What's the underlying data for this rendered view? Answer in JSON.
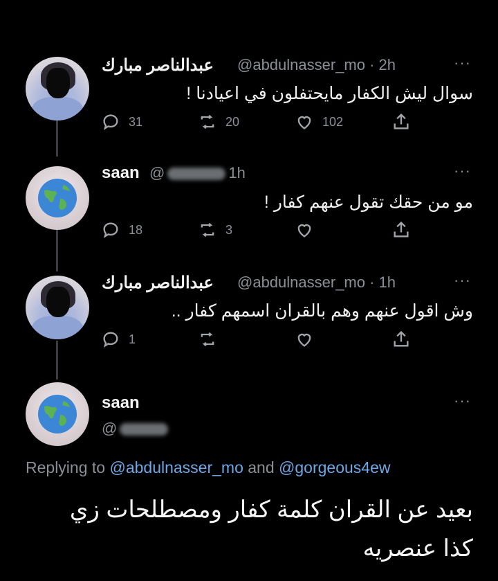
{
  "tweets": [
    {
      "name": "عبدالناصر مبارك",
      "handle": "@abdulnasser_mo · 2h",
      "more": "···",
      "text": "سوال ليش الكفار مايحتفلون في اعيادنا !",
      "replies": "31",
      "retweets": "20",
      "likes": "102"
    },
    {
      "name": "saan",
      "handle_prefix": "@",
      "handle_suffix": "1h",
      "more": "···",
      "text": "مو من حقك تقول عنهم كفار !",
      "replies": "18",
      "retweets": "3",
      "likes": ""
    },
    {
      "name": "عبدالناصر مبارك",
      "handle": "@abdulnasser_mo · 1h",
      "more": "···",
      "text": "وش اقول عنهم وهم بالقران اسمهم كفار ..",
      "replies": "1",
      "retweets": "",
      "likes": ""
    },
    {
      "name": "saan",
      "handle_prefix": "@",
      "more": "···"
    }
  ],
  "replying": {
    "prefix": "Replying to",
    "user1": "@abdulnasser_mo",
    "and": "and",
    "user2": "@gorgeous4ew"
  },
  "main_text": {
    "line1": "بعيد عن القران كلمة كفار ومصطلحات زي",
    "line2": "كذا عنصريه"
  },
  "icons": [
    "reply-icon",
    "retweet-icon",
    "like-icon",
    "share-icon",
    "globe-icon"
  ],
  "colors": {
    "background": "#000000",
    "muted": "#8b9096",
    "link": "#6ea8e6"
  }
}
